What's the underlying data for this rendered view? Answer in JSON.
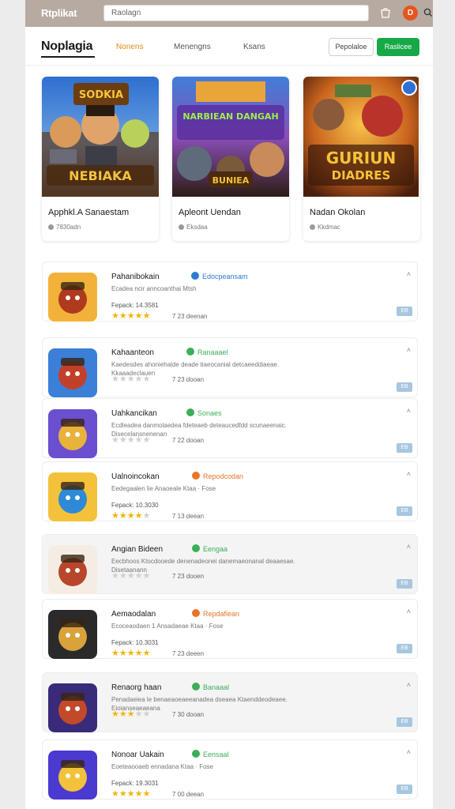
{
  "topbar": {
    "brand": "Rtplikat",
    "search_placeholder": "Raolagn",
    "avatar_initial": "D"
  },
  "nav": {
    "logo": "Noplagia",
    "tabs": [
      "Nonens",
      "Menengns",
      "Ksans"
    ],
    "active_tab": 0,
    "outline_button": "Pepolaloe",
    "green_button": "Raslicee"
  },
  "featured": [
    {
      "title": "Apphkl.A Sanaestam",
      "meta": "7830adn",
      "art_top": "SODKIA",
      "art_bottom": "NEBIAKA"
    },
    {
      "title": "Apleont Uendan",
      "meta": "Eksdaa",
      "art_top": "NARBIEAN DANGAH",
      "art_bottom": "BUNIEA"
    },
    {
      "title": "Nadan Okolan",
      "meta": "Kkdmac",
      "art_top": "GURIUN",
      "art_bottom": "DIADRES"
    }
  ],
  "list": [
    {
      "name": "Pahanibokain",
      "tag": "Edocpeansam",
      "tag_color": "#2e7ad1",
      "desc": "Ecadea ncir anncoanthai Mtsh",
      "price": "Fepack: 14.3581",
      "rating": 5,
      "downloads": "7 23 deenan",
      "badge": "EB"
    },
    {
      "name": "Kahaanteon",
      "tag": "Ranaaael",
      "tag_color": "#3cae57",
      "desc": "Kaedesdes ahoniehalde deade tiaeocanial detcaeeddiaeae. Kkaaadeclauen",
      "price": "",
      "rating": 0,
      "downloads": "7 23 dooan",
      "badge": "EB"
    },
    {
      "name": "Uahkancikan",
      "tag": "Sonaes",
      "tag_color": "#3cae57",
      "desc": "Ecdleadea danmolaedea fdeteaeb deteaucedfdd scunaeenaic. Disecelansnenenan",
      "price": "",
      "rating": 0,
      "downloads": "7 22 dooan",
      "badge": "EB"
    },
    {
      "name": "Ualnoincokan",
      "tag": "Repodcodan",
      "tag_color": "#e8742a",
      "desc": "Eedegaalen lie Anaoeale Ktaa · Fose",
      "price": "Fepack: 10.3030",
      "rating": 4,
      "downloads": "7 13 deean",
      "badge": "EB"
    },
    {
      "name": "Angian Bideen",
      "tag": "Eengaa",
      "tag_color": "#3cae57",
      "desc": "Eecbhoos Ktocdooede denenadeonei danemaeonanal deaaesae. Disetaanann",
      "price": "",
      "rating": 0,
      "downloads": "7 23 dooen",
      "badge": "EB"
    },
    {
      "name": "Aemaodalan",
      "tag": "Repdafiean",
      "tag_color": "#e8742a",
      "desc": "Ecoceaodaen 1 Ansadaeae Ktaa · Fose",
      "price": "Fepack: 10.3031",
      "rating": 5,
      "downloads": "7 23 deeen",
      "badge": "EB"
    },
    {
      "name": "Renaorg haan",
      "tag": "Banaaal",
      "tag_color": "#3cae57",
      "desc": "Penadaeiea le benaeaoeaeeanadea dseaea Ktaenddeodeaee. Eioianseaeaeana",
      "price": "",
      "rating": 3,
      "downloads": "7 30 dooan",
      "badge": "EB"
    },
    {
      "name": "Nonoar Uakain",
      "tag": "Eensaal",
      "tag_color": "#3cae57",
      "desc": "Eoeteaooaeb ennadana Ktaa · Fose",
      "price": "Fepack: 19.3031",
      "rating": 5,
      "downloads": "7 00 deean",
      "badge": "EB"
    }
  ]
}
